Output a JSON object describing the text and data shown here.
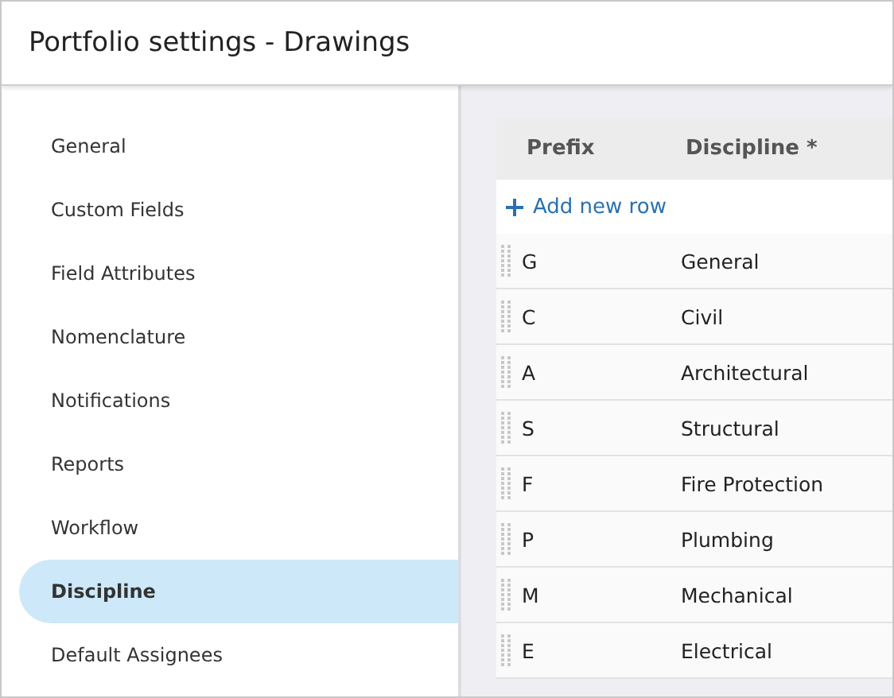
{
  "window": {
    "title": "Portfolio settings - Drawings"
  },
  "sidebar": {
    "items": [
      {
        "label": "General",
        "selected": false
      },
      {
        "label": "Custom Fields",
        "selected": false
      },
      {
        "label": "Field Attributes",
        "selected": false
      },
      {
        "label": "Nomenclature",
        "selected": false
      },
      {
        "label": "Notifications",
        "selected": false
      },
      {
        "label": "Reports",
        "selected": false
      },
      {
        "label": "Workflow",
        "selected": false
      },
      {
        "label": "Discipline",
        "selected": true
      },
      {
        "label": "Default Assignees",
        "selected": false
      }
    ]
  },
  "table": {
    "columns": [
      "Prefix",
      "Discipline *"
    ],
    "add_row": "Add new row",
    "rows": [
      {
        "prefix": "G",
        "discipline": "General"
      },
      {
        "prefix": "C",
        "discipline": "Civil"
      },
      {
        "prefix": "A",
        "discipline": "Architectural"
      },
      {
        "prefix": "S",
        "discipline": "Structural"
      },
      {
        "prefix": "F",
        "discipline": "Fire Protection"
      },
      {
        "prefix": "P",
        "discipline": "Plumbing"
      },
      {
        "prefix": "M",
        "discipline": "Mechanical"
      },
      {
        "prefix": "E",
        "discipline": "Electrical"
      }
    ]
  }
}
